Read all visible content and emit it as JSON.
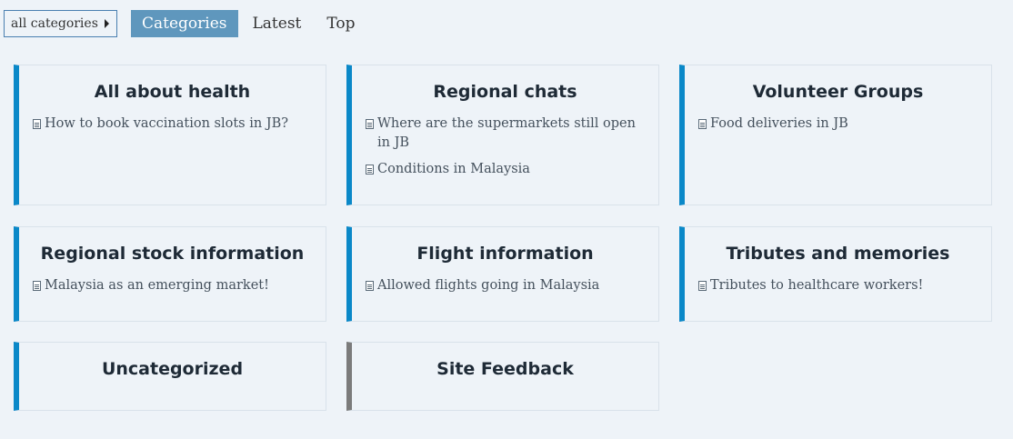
{
  "nav": {
    "category_select": "all categories",
    "tabs": [
      {
        "label": "Categories"
      },
      {
        "label": "Latest"
      },
      {
        "label": "Top"
      }
    ]
  },
  "categories": [
    {
      "title": "All about health",
      "color": "#0a88c8",
      "topics": [
        "How to book vaccination slots in JB?"
      ]
    },
    {
      "title": "Regional chats",
      "color": "#0a88c8",
      "topics": [
        "Where are the supermarkets still open in JB",
        "Conditions in Malaysia"
      ]
    },
    {
      "title": "Volunteer Groups",
      "color": "#0a88c8",
      "topics": [
        "Food deliveries in JB"
      ]
    },
    {
      "title": "Regional stock information",
      "color": "#0a88c8",
      "topics": [
        "Malaysia as an emerging market!"
      ]
    },
    {
      "title": "Flight information",
      "color": "#0a88c8",
      "topics": [
        "Allowed flights going in Malaysia"
      ]
    },
    {
      "title": "Tributes and memories",
      "color": "#0a88c8",
      "topics": [
        "Tributes to healthcare workers!"
      ]
    },
    {
      "title": "Uncategorized",
      "color": "#0a88c8",
      "topics": []
    },
    {
      "title": "Site Feedback",
      "color": "#7b7b7b",
      "topics": []
    }
  ]
}
